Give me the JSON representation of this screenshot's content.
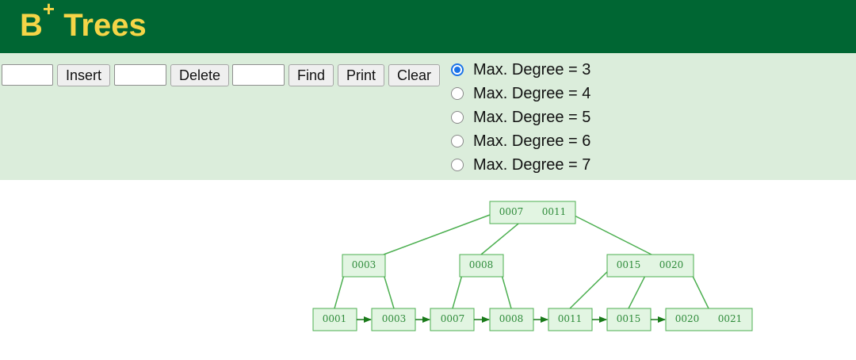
{
  "header": {
    "title": "B",
    "title_sup": "+",
    "title_rest": "Trees",
    "bg_color": "#006633",
    "title_color": "#f5d547"
  },
  "controls": {
    "insert_value": "",
    "insert_label": "Insert",
    "delete_value": "",
    "delete_label": "Delete",
    "find_value": "",
    "find_label": "Find",
    "print_label": "Print",
    "clear_label": "Clear",
    "bg_color": "#dbeddb",
    "degree_options": [
      {
        "label": "Max. Degree = 3",
        "checked": true
      },
      {
        "label": "Max. Degree = 4",
        "checked": false
      },
      {
        "label": "Max. Degree = 5",
        "checked": false
      },
      {
        "label": "Max. Degree = 6",
        "checked": false
      },
      {
        "label": "Max. Degree = 7",
        "checked": false
      }
    ]
  },
  "tree": {
    "node_color": "#2e8b3a",
    "root": [
      "0007",
      "0011"
    ],
    "internal": [
      [
        "0003"
      ],
      [
        "0008"
      ],
      [
        "0015",
        "0020"
      ]
    ],
    "leaves": [
      [
        "0001"
      ],
      [
        "0003"
      ],
      [
        "0007"
      ],
      [
        "0008"
      ],
      [
        "0011"
      ],
      [
        "0015"
      ],
      [
        "0020",
        "0021"
      ]
    ]
  }
}
